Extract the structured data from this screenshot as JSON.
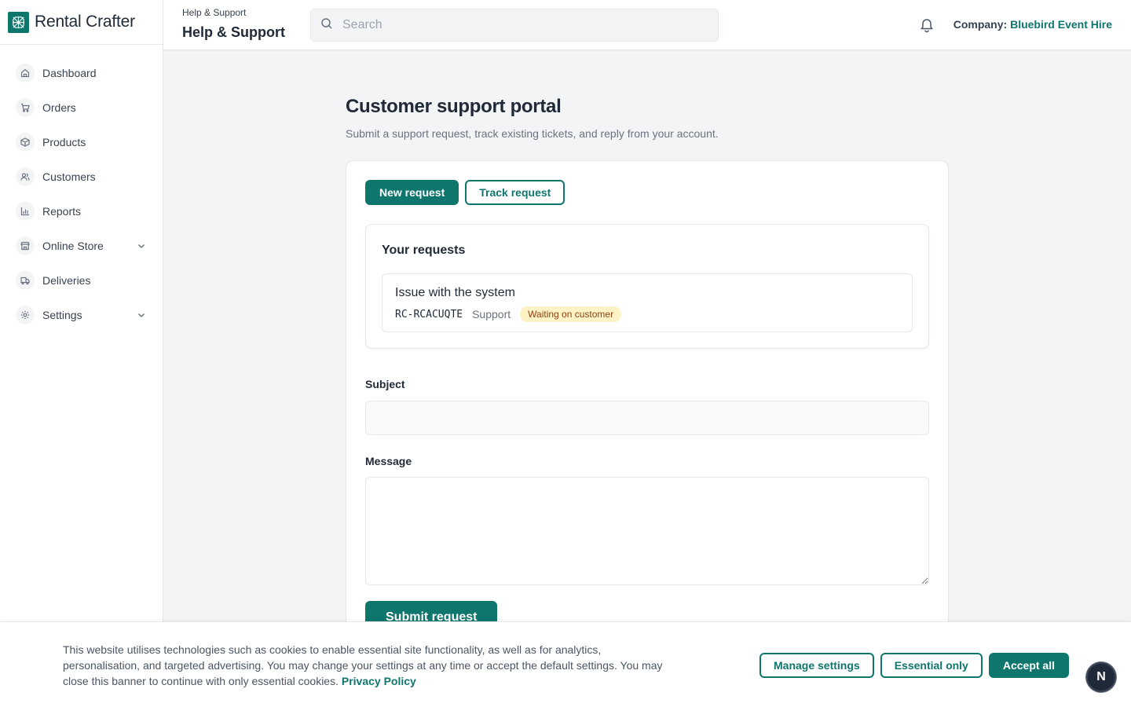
{
  "brand": {
    "name": "Rental Crafter",
    "accent": "#0f766e"
  },
  "sidebar": {
    "items": [
      {
        "label": "Dashboard",
        "icon": "home-icon"
      },
      {
        "label": "Orders",
        "icon": "cart-icon"
      },
      {
        "label": "Products",
        "icon": "box-icon"
      },
      {
        "label": "Customers",
        "icon": "users-icon"
      },
      {
        "label": "Reports",
        "icon": "bar-chart-icon"
      },
      {
        "label": "Online Store",
        "icon": "store-icon",
        "expandable": true
      },
      {
        "label": "Deliveries",
        "icon": "truck-icon"
      },
      {
        "label": "Settings",
        "icon": "gear-icon",
        "expandable": true
      }
    ]
  },
  "header": {
    "breadcrumb": "Help & Support",
    "title": "Help & Support",
    "search_placeholder": "Search",
    "company_label": "Company:",
    "company_name": "Bluebird Event Hire"
  },
  "main": {
    "title": "Customer support portal",
    "subtitle": "Submit a support request, track existing tickets, and reply from your account.",
    "tabs": {
      "new_label": "New request",
      "track_label": "Track request",
      "active": "new"
    },
    "requests": {
      "title": "Your requests",
      "items": [
        {
          "subject": "Issue with the system",
          "id": "RC-RCACUQTE",
          "category": "Support",
          "status": "Waiting on customer"
        }
      ]
    },
    "form": {
      "subject_label": "Subject",
      "subject_value": "",
      "message_label": "Message",
      "message_value": "",
      "submit_label": "Submit request"
    }
  },
  "cookie": {
    "text": "This website utilises technologies such as cookies to enable essential site functionality, as well as for analytics, personalisation, and targeted advertising. You may change your settings at any time or accept the default settings. You may close this banner to continue with only essential cookies.",
    "link": "Privacy Policy",
    "manage_label": "Manage settings",
    "essential_label": "Essential only",
    "accept_label": "Accept all"
  },
  "floating_badge": "N"
}
